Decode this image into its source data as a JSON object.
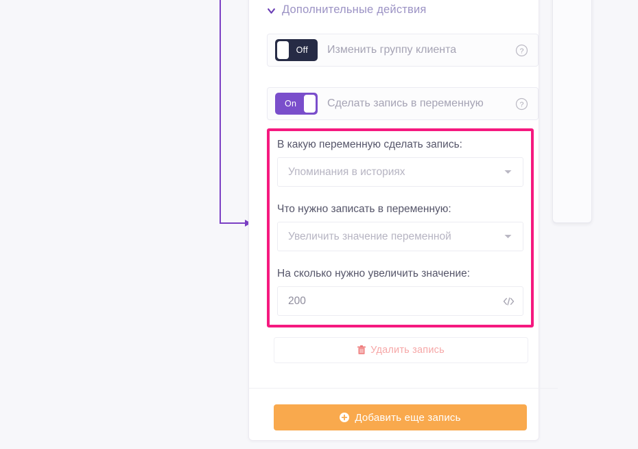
{
  "section": {
    "title": "Дополнительные действия",
    "chevron_icon": "chevron-down-icon"
  },
  "toggles": [
    {
      "state_label": "Off",
      "enabled": false,
      "label": "Изменить группу клиента",
      "help_icon": "help-circle-icon"
    },
    {
      "state_label": "On",
      "enabled": true,
      "label": "Сделать запись в переменную",
      "help_icon": "help-circle-icon"
    }
  ],
  "form": {
    "variable": {
      "label": "В какую переменную сделать запись:",
      "value": "Упоминания в историях",
      "caret_icon": "chevron-down-icon"
    },
    "action": {
      "label": "Что нужно записать в переменную:",
      "value": "Увеличить значение переменной",
      "caret_icon": "chevron-down-icon"
    },
    "amount": {
      "label": "На сколько нужно увеличить значение:",
      "value": "200",
      "code_icon": "code-brackets-icon"
    }
  },
  "delete_button": {
    "label": "Удалить запись",
    "icon": "trash-icon"
  },
  "add_button": {
    "label": "Добавить еще запись",
    "icon": "plus-circle-icon"
  },
  "colors": {
    "highlight_border": "#f5197f",
    "toggle_on": "#7a4ecb",
    "toggle_off": "#262b45",
    "add_button": "#f9a94d",
    "delete_text": "#f6a7a7",
    "section_title": "#9b92c4",
    "connector": "#7b3fc4"
  }
}
